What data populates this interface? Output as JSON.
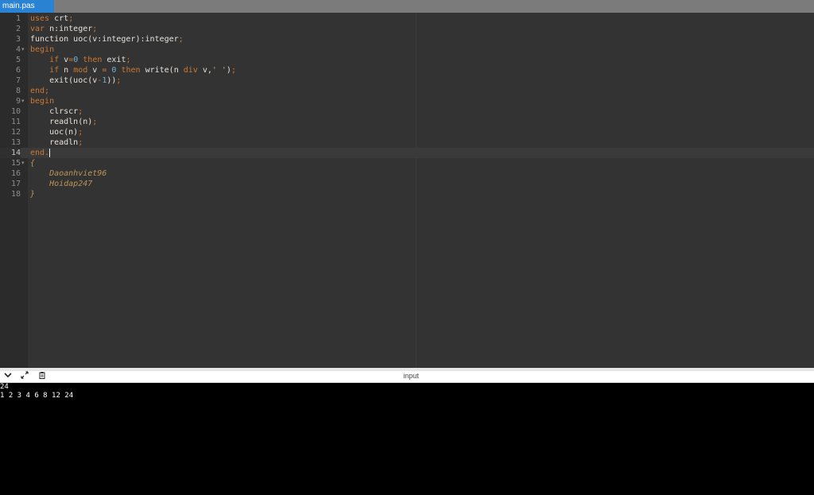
{
  "tab": {
    "filename": "main.pas"
  },
  "editor": {
    "active_line": 14,
    "lines": [
      {
        "n": "1",
        "fold": false,
        "tokens": [
          [
            "kw",
            "uses"
          ],
          [
            "pl",
            " crt"
          ],
          [
            "kw",
            ";"
          ]
        ]
      },
      {
        "n": "2",
        "fold": false,
        "tokens": [
          [
            "kw",
            "var"
          ],
          [
            "pl",
            " n:integer"
          ],
          [
            "kw",
            ";"
          ]
        ]
      },
      {
        "n": "3",
        "fold": false,
        "tokens": [
          [
            "pl",
            "function uoc(v:integer):integer"
          ],
          [
            "kw",
            ";"
          ]
        ]
      },
      {
        "n": "4",
        "fold": true,
        "tokens": [
          [
            "kw",
            "begin"
          ]
        ]
      },
      {
        "n": "5",
        "fold": false,
        "tokens": [
          [
            "pl",
            "    "
          ],
          [
            "kw",
            "if"
          ],
          [
            "pl",
            " v"
          ],
          [
            "kw",
            "="
          ],
          [
            "num",
            "0"
          ],
          [
            "pl",
            " "
          ],
          [
            "kw",
            "then"
          ],
          [
            "pl",
            " exit"
          ],
          [
            "kw",
            ";"
          ]
        ]
      },
      {
        "n": "6",
        "fold": false,
        "tokens": [
          [
            "pl",
            "    "
          ],
          [
            "kw",
            "if"
          ],
          [
            "pl",
            " n "
          ],
          [
            "kw",
            "mod"
          ],
          [
            "pl",
            " v "
          ],
          [
            "kw",
            "="
          ],
          [
            "pl",
            " "
          ],
          [
            "num",
            "0"
          ],
          [
            "pl",
            " "
          ],
          [
            "kw",
            "then"
          ],
          [
            "pl",
            " write(n "
          ],
          [
            "kw",
            "div"
          ],
          [
            "pl",
            " v,"
          ],
          [
            "str",
            "' '"
          ],
          [
            "pl",
            ")"
          ],
          [
            "kw",
            ";"
          ]
        ]
      },
      {
        "n": "7",
        "fold": false,
        "tokens": [
          [
            "pl",
            "    exit(uoc(v"
          ],
          [
            "kw",
            "-"
          ],
          [
            "num",
            "1"
          ],
          [
            "pl",
            "))"
          ],
          [
            "kw",
            ";"
          ]
        ]
      },
      {
        "n": "8",
        "fold": false,
        "tokens": [
          [
            "kw",
            "end;"
          ]
        ]
      },
      {
        "n": "9",
        "fold": true,
        "tokens": [
          [
            "kw",
            "begin"
          ]
        ]
      },
      {
        "n": "10",
        "fold": false,
        "tokens": [
          [
            "pl",
            "    clrscr"
          ],
          [
            "kw",
            ";"
          ]
        ]
      },
      {
        "n": "11",
        "fold": false,
        "tokens": [
          [
            "pl",
            "    readln(n)"
          ],
          [
            "kw",
            ";"
          ]
        ]
      },
      {
        "n": "12",
        "fold": false,
        "tokens": [
          [
            "pl",
            "    uoc(n)"
          ],
          [
            "kw",
            ";"
          ]
        ]
      },
      {
        "n": "13",
        "fold": false,
        "tokens": [
          [
            "pl",
            "    readln"
          ],
          [
            "kw",
            ";"
          ]
        ]
      },
      {
        "n": "14",
        "fold": false,
        "cursor": true,
        "tokens": [
          [
            "kw",
            "end."
          ]
        ]
      },
      {
        "n": "15",
        "fold": true,
        "tokens": [
          [
            "cm",
            "{"
          ]
        ]
      },
      {
        "n": "16",
        "fold": false,
        "tokens": [
          [
            "cm",
            "    Daoanhviet96"
          ]
        ]
      },
      {
        "n": "17",
        "fold": false,
        "tokens": [
          [
            "cm",
            "    Hoidap247"
          ]
        ]
      },
      {
        "n": "18",
        "fold": false,
        "tokens": [
          [
            "cm",
            "}"
          ]
        ]
      }
    ]
  },
  "panel": {
    "title": "input",
    "icons": [
      "chevron-down-icon",
      "expand-icon",
      "clipboard-icon"
    ]
  },
  "console": {
    "lines": [
      "24",
      "1 2 3 4 6 8 12 24"
    ]
  }
}
